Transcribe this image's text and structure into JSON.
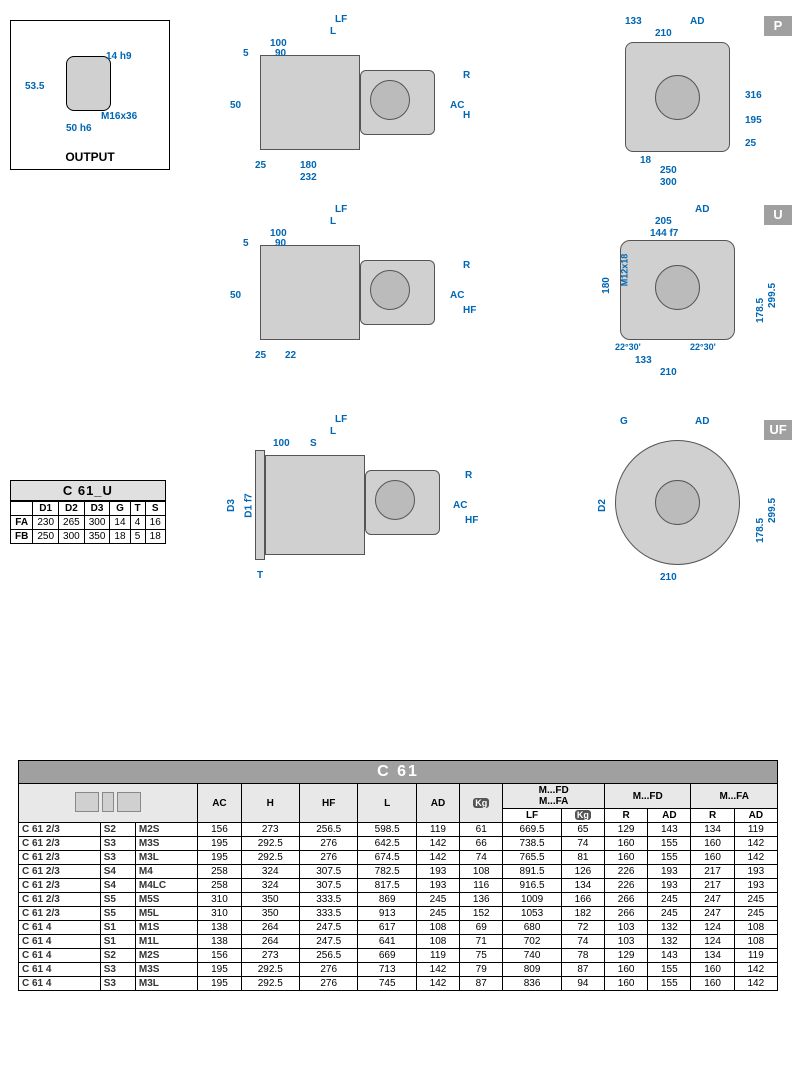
{
  "output": {
    "title": "OUTPUT",
    "dims": {
      "d1": "14 h9",
      "d2": "53.5",
      "d3": "50 h6",
      "d4": "M16x36"
    }
  },
  "flags": {
    "p": "P",
    "u": "U",
    "uf": "UF"
  },
  "dwg_p": {
    "labels": {
      "LF": "LF",
      "L": "L",
      "n100": "100",
      "n5": "5",
      "n90": "90",
      "n50": "50",
      "n25": "25",
      "n180": "180",
      "n232": "232",
      "AC": "AC",
      "H": "H",
      "R": "R",
      "n133": "133",
      "AD": "AD",
      "n210": "210",
      "n18": "18",
      "n25b": "25",
      "n195": "195",
      "n250": "250",
      "n300": "300",
      "n316": "316"
    }
  },
  "dwg_u": {
    "labels": {
      "LF": "LF",
      "L": "L",
      "n100": "100",
      "n5": "5",
      "n90": "90",
      "n50": "50",
      "n25": "25",
      "n22": "22",
      "AC": "AC",
      "HF": "HF",
      "R": "R",
      "AD": "AD",
      "n205": "205",
      "n144": "144 f7",
      "n180": "180",
      "M12x18": "M12x18",
      "n1785": "178.5",
      "n2995": "299.5",
      "a1": "22°30'",
      "a2": "22°30'",
      "n133": "133",
      "n210": "210"
    }
  },
  "dwg_uf": {
    "labels": {
      "LF": "LF",
      "L": "L",
      "n100": "100",
      "S": "S",
      "D3": "D3",
      "D1": "D1 f7",
      "T": "T",
      "AC": "AC",
      "HF": "HF",
      "R": "R",
      "G": "G",
      "AD": "AD",
      "D2": "D2",
      "n210": "210",
      "n1785": "178.5",
      "n2995": "299.5"
    }
  },
  "small_table": {
    "title": "C 61_U",
    "headers": [
      "D1",
      "D2",
      "D3",
      "G",
      "T",
      "S"
    ],
    "rows": [
      {
        "label": "FA",
        "cells": [
          "230",
          "265",
          "300",
          "14",
          "4",
          "16"
        ]
      },
      {
        "label": "FB",
        "cells": [
          "250",
          "300",
          "350",
          "18",
          "5",
          "18"
        ]
      }
    ]
  },
  "main_table": {
    "title": "C 61",
    "group_headers": {
      "g1": "M...FD\nM...FA",
      "g2": "M...FD",
      "g3": "M...FA"
    },
    "col_headers": [
      "AC",
      "H",
      "HF",
      "L",
      "AD",
      "Kg",
      "LF",
      "Kg",
      "R",
      "AD",
      "R",
      "AD"
    ],
    "rows": [
      {
        "model": "C 61 2/3",
        "s": "S2",
        "m": "M2S",
        "cells": [
          "156",
          "273",
          "256.5",
          "598.5",
          "119",
          "61",
          "669.5",
          "65",
          "129",
          "143",
          "134",
          "119"
        ]
      },
      {
        "model": "C 61 2/3",
        "s": "S3",
        "m": "M3S",
        "cells": [
          "195",
          "292.5",
          "276",
          "642.5",
          "142",
          "66",
          "738.5",
          "74",
          "160",
          "155",
          "160",
          "142"
        ]
      },
      {
        "model": "C 61 2/3",
        "s": "S3",
        "m": "M3L",
        "cells": [
          "195",
          "292.5",
          "276",
          "674.5",
          "142",
          "74",
          "765.5",
          "81",
          "160",
          "155",
          "160",
          "142"
        ]
      },
      {
        "model": "C 61 2/3",
        "s": "S4",
        "m": "M4",
        "cells": [
          "258",
          "324",
          "307.5",
          "782.5",
          "193",
          "108",
          "891.5",
          "126",
          "226",
          "193",
          "217",
          "193"
        ]
      },
      {
        "model": "C 61 2/3",
        "s": "S4",
        "m": "M4LC",
        "cells": [
          "258",
          "324",
          "307.5",
          "817.5",
          "193",
          "116",
          "916.5",
          "134",
          "226",
          "193",
          "217",
          "193"
        ]
      },
      {
        "model": "C 61 2/3",
        "s": "S5",
        "m": "M5S",
        "cells": [
          "310",
          "350",
          "333.5",
          "869",
          "245",
          "136",
          "1009",
          "166",
          "266",
          "245",
          "247",
          "245"
        ]
      },
      {
        "model": "C 61 2/3",
        "s": "S5",
        "m": "M5L",
        "cells": [
          "310",
          "350",
          "333.5",
          "913",
          "245",
          "152",
          "1053",
          "182",
          "266",
          "245",
          "247",
          "245"
        ]
      },
      {
        "model": "C 61 4",
        "s": "S1",
        "m": "M1S",
        "cells": [
          "138",
          "264",
          "247.5",
          "617",
          "108",
          "69",
          "680",
          "72",
          "103",
          "132",
          "124",
          "108"
        ]
      },
      {
        "model": "C 61 4",
        "s": "S1",
        "m": "M1L",
        "cells": [
          "138",
          "264",
          "247.5",
          "641",
          "108",
          "71",
          "702",
          "74",
          "103",
          "132",
          "124",
          "108"
        ]
      },
      {
        "model": "C 61 4",
        "s": "S2",
        "m": "M2S",
        "cells": [
          "156",
          "273",
          "256.5",
          "669",
          "119",
          "75",
          "740",
          "78",
          "129",
          "143",
          "134",
          "119"
        ]
      },
      {
        "model": "C 61 4",
        "s": "S3",
        "m": "M3S",
        "cells": [
          "195",
          "292.5",
          "276",
          "713",
          "142",
          "79",
          "809",
          "87",
          "160",
          "155",
          "160",
          "142"
        ]
      },
      {
        "model": "C 61 4",
        "s": "S3",
        "m": "M3L",
        "cells": [
          "195",
          "292.5",
          "276",
          "745",
          "142",
          "87",
          "836",
          "94",
          "160",
          "155",
          "160",
          "142"
        ]
      }
    ]
  }
}
